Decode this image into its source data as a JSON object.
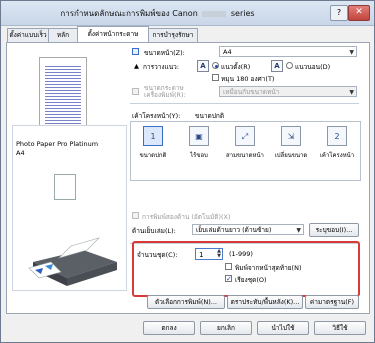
{
  "window": {
    "title_prefix": "การกำหนดลักษณะการพิมพ์ของ Canon",
    "title_suffix": "series",
    "help": "?",
    "close": "✕"
  },
  "tabs": [
    {
      "label": "ตั้งค่าแบบเร็ว"
    },
    {
      "label": "หลัก"
    },
    {
      "label": "ตั้งค่าหน้ากระดาษ"
    },
    {
      "label": "การบำรุงรักษา"
    }
  ],
  "media": {
    "name": "Photo Paper Pro Platinum\nA4"
  },
  "page_setup": {
    "page_size_label": "ขนาดหน้า(Z):",
    "page_size_value": "A4",
    "orientation_label": "การวางแนว:",
    "portrait_label": "แนวตั้ง(R)",
    "landscape_label": "แนวนอน(D)",
    "rotate_label": "หมุน 180 องศา(T)",
    "printer_paper_label": "ขนาดกระดาษเครื่องพิมพ์(R):",
    "printer_paper_value": "เหมือนกับขนาดหน้า"
  },
  "layout": {
    "label": "เค้าโครงหน้า(Y):",
    "current": "ขนาดปกติ",
    "items": [
      {
        "label": "ขนาดปกติ",
        "icon": "1"
      },
      {
        "label": "ไร้ขอบ",
        "icon": "▣"
      },
      {
        "label": "สามขนาดหน้า",
        "icon": "⤢"
      },
      {
        "label": "เปลี่ยนขนาด",
        "icon": "⇲"
      },
      {
        "label": "เค้าโครงหน้า",
        "icon": "2"
      }
    ]
  },
  "duplex": {
    "auto_label": "การพิมพ์สองด้าน (อัตโนมัติ)(X)",
    "stapling_label": "ด้านเย็บเล่ม(L):",
    "stapling_value": "เย็บเล่มด้านยาว (ด้านซ้าย)",
    "margin_button": "ระบุขอบ(I)..."
  },
  "copies": {
    "label": "จำนวนชุด(C):",
    "value": "1",
    "range": "(1-999)",
    "reverse_label": "พิมพ์จากหน้าสุดท้าย(N)",
    "collate_label": "เรียงชุด(O)"
  },
  "buttons": {
    "print_options": "ตัวเลือกการพิมพ์(N)...",
    "stamp": "ตราประทับ/พื้นหลัง(K)...",
    "defaults": "ค่ามาตรฐาน(F)",
    "ok": "ตกลง",
    "cancel": "ยกเลิก",
    "apply": "นำไปใช้",
    "help": "วิธีใช้"
  }
}
